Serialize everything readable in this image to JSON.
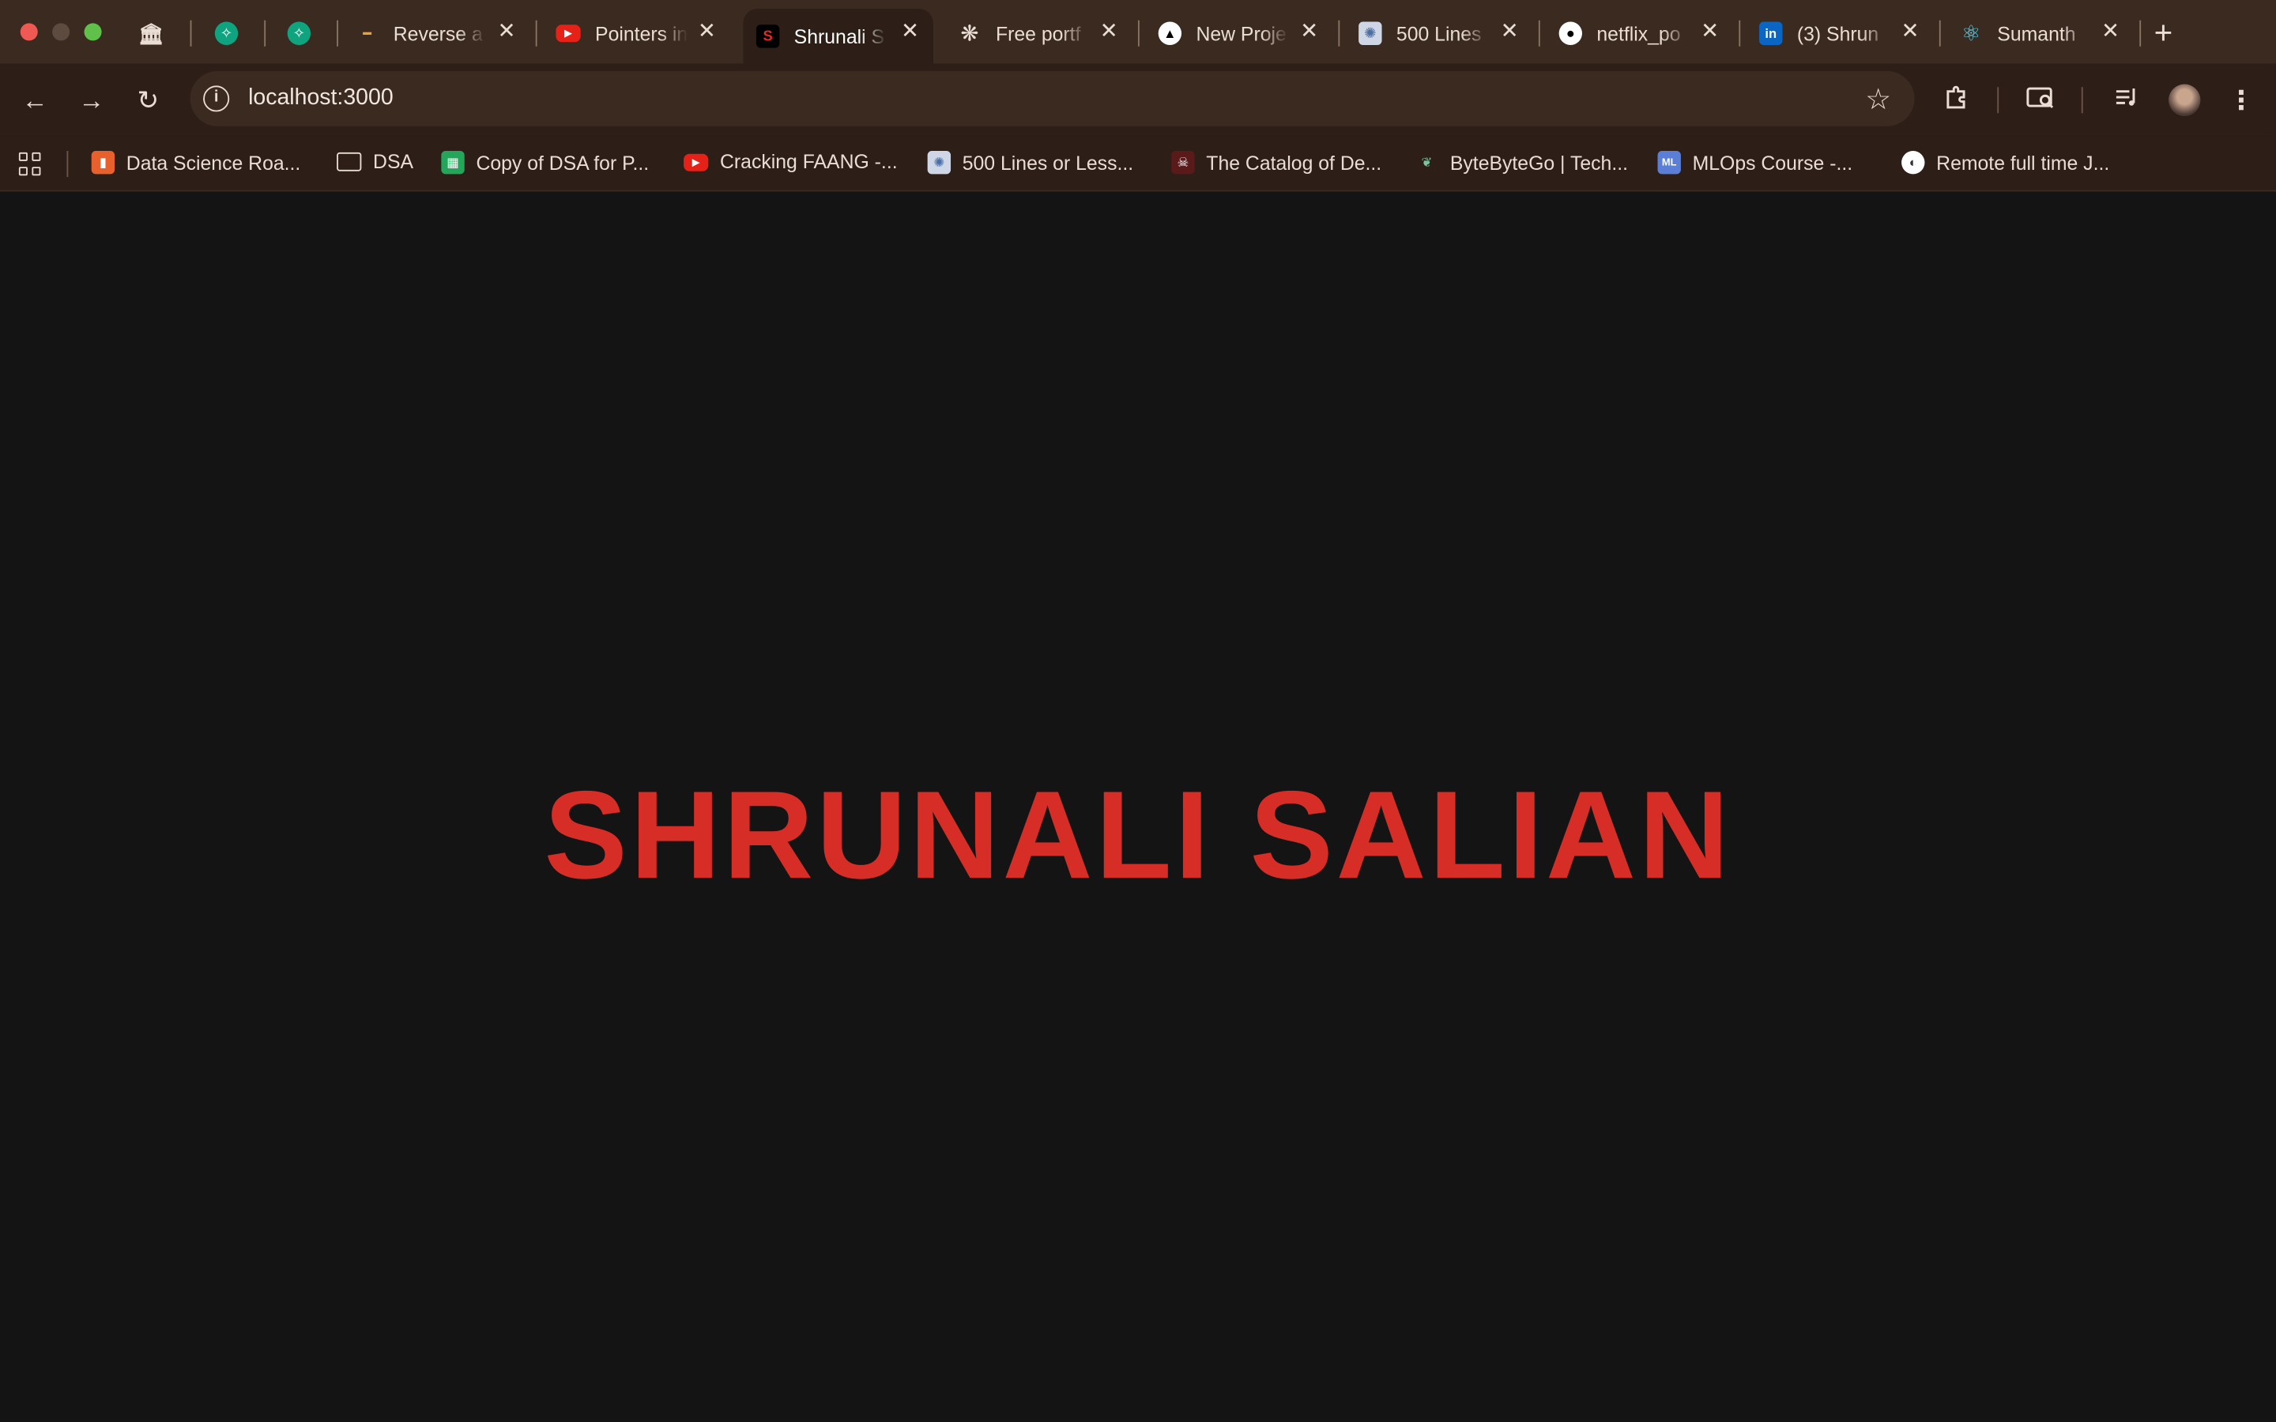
{
  "browser": {
    "tabs": [
      {
        "title": "",
        "favicon": "museum-icon"
      },
      {
        "title": "",
        "favicon": "chatgpt-green-icon"
      },
      {
        "title": "",
        "favicon": "chatgpt-green-icon"
      },
      {
        "title": "Reverse a",
        "favicon": "course-icon"
      },
      {
        "title": "Pointers in",
        "favicon": "youtube-icon"
      },
      {
        "title": "Shrunali S",
        "favicon": "s-logo-icon",
        "active": true
      },
      {
        "title": "Free portf",
        "favicon": "openai-icon"
      },
      {
        "title": "New Proje",
        "favicon": "vercel-icon"
      },
      {
        "title": "500 Lines",
        "favicon": "aosa-icon"
      },
      {
        "title": "netflix_po",
        "favicon": "github-icon"
      },
      {
        "title": "(3) Shrun",
        "favicon": "linkedin-icon"
      },
      {
        "title": "Sumanth",
        "favicon": "react-icon"
      }
    ],
    "new_tab": "+",
    "address": {
      "url": "localhost:3000"
    },
    "bookmarks": [
      {
        "label": "Data Science Roa...",
        "favicon": "bookmark-orange-icon"
      },
      {
        "label": "DSA",
        "favicon": "folder-icon"
      },
      {
        "label": "Copy of DSA for P...",
        "favicon": "sheets-icon"
      },
      {
        "label": "Cracking FAANG -...",
        "favicon": "youtube-icon"
      },
      {
        "label": "500 Lines or Less...",
        "favicon": "aosa-icon"
      },
      {
        "label": "The Catalog of De...",
        "favicon": "catalog-icon"
      },
      {
        "label": "ByteByteGo | Tech...",
        "favicon": "bytebytego-icon"
      },
      {
        "label": "MLOps Course -...",
        "favicon": "mlops-icon"
      },
      {
        "label": "Remote full time J...",
        "favicon": "remote-icon"
      }
    ]
  },
  "page": {
    "hero_text": "SHRUNALI SALIAN",
    "hero_color": "#d62d26",
    "background": "#141414"
  }
}
